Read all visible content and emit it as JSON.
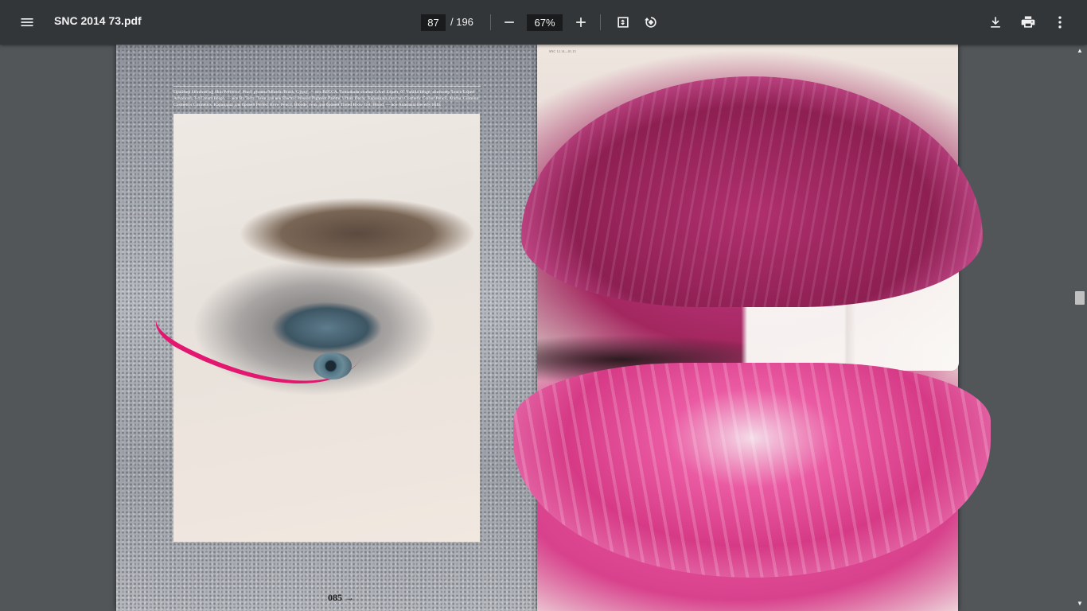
{
  "toolbar": {
    "title": "SNC 2014 73.pdf",
    "page_current": "87",
    "page_total": "/ 196",
    "zoom": "67%",
    "icons": {
      "menu": "menu-icon",
      "zoom_out": "minus-icon",
      "zoom_in": "plus-icon",
      "fit": "fit-to-page-icon",
      "rotate": "rotate-icon",
      "download": "download-icon",
      "print": "print-icon",
      "more": "more-vert-icon"
    }
  },
  "document": {
    "left_page": {
      "caption": "Праймер Shimmering Skin Perfector, Pearl; румяна Mineral Blush, Gypsy, — все BECCA. Тональная основа Cover Expert, 07 Vanilla Beige; консилер Touch Expert Advanced, 3-4 Cream Beige, — все By Terry. Тени для век Electric Pressed Pigment Palette, Urban Decay. Карандаш для глаз Cosmetic Colour Pencil, Anima, Glamour Cosmetics Cosmetics. Карандаш для бровей Perfect Brow Pencil, Blonde; гель для бровей Tinted Brow Gel, Blond, — все Anastasia Beverly Hills",
      "page_number": "085 →"
    },
    "right_page": {
      "caption": "SNC 12.14—01.15"
    }
  },
  "colors": {
    "toolbar_bg": "#323639",
    "viewer_bg": "#525659",
    "eyeliner": "#e3176f",
    "lip": "#d63a86"
  }
}
